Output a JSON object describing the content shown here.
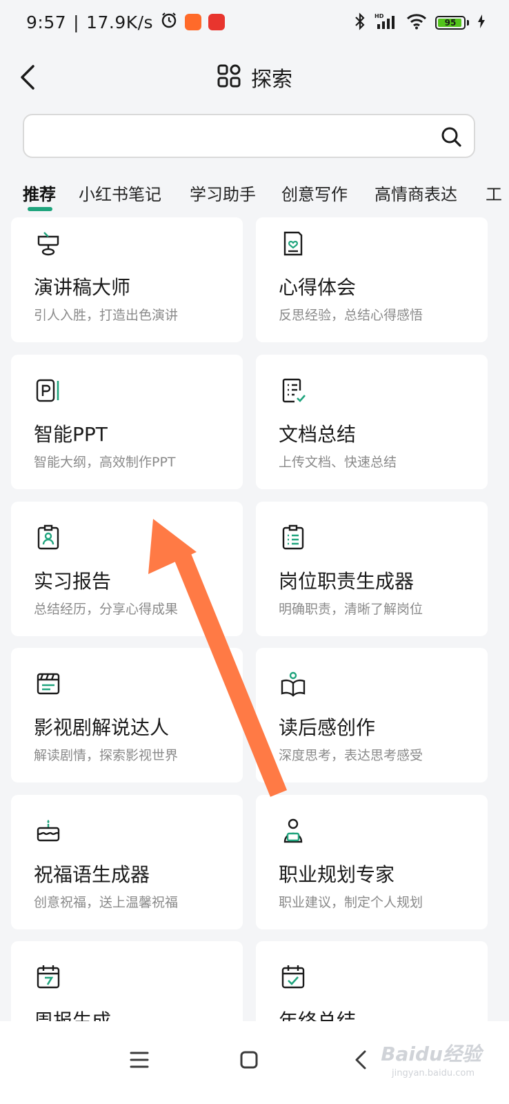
{
  "status_bar": {
    "time": "9:57",
    "speed": "17.9K/s",
    "battery_level": 95,
    "battery_label": "95",
    "network": "HD"
  },
  "header": {
    "title": "探索",
    "back_icon": "chevron-left-icon",
    "title_icon": "grid-apps-icon"
  },
  "search": {
    "placeholder": "",
    "value": ""
  },
  "tabs": [
    {
      "label": "推荐",
      "active": true
    },
    {
      "label": "小红书笔记"
    },
    {
      "label": "学习助手"
    },
    {
      "label": "创意写作"
    },
    {
      "label": "高情商表达"
    },
    {
      "label": "工"
    }
  ],
  "cards": [
    {
      "title": "演讲稿大师",
      "desc": "引人入胜，打造出色演讲",
      "icon": "podium-icon"
    },
    {
      "title": "心得体会",
      "desc": "反思经验，总结心得感悟",
      "icon": "heart-document-icon"
    },
    {
      "title": "智能PPT",
      "desc": "智能大纲，高效制作PPT",
      "icon": "ppt-icon"
    },
    {
      "title": "文档总结",
      "desc": "上传文档、快速总结",
      "icon": "document-check-icon"
    },
    {
      "title": "实习报告",
      "desc": "总结经历，分享心得成果",
      "icon": "badge-person-icon"
    },
    {
      "title": "岗位职责生成器",
      "desc": "明确职责，清晰了解岗位",
      "icon": "clipboard-list-icon"
    },
    {
      "title": "影视剧解说达人",
      "desc": "解读剧情，探索影视世界",
      "icon": "clapperboard-icon"
    },
    {
      "title": "读后感创作",
      "desc": "深度思考，表达思考感受",
      "icon": "reading-book-icon"
    },
    {
      "title": "祝福语生成器",
      "desc": "创意祝福，送上温馨祝福",
      "icon": "cake-icon"
    },
    {
      "title": "职业规划专家",
      "desc": "职业建议，制定个人规划",
      "icon": "person-laptop-icon"
    },
    {
      "title": "周报生成",
      "desc": "",
      "icon": "calendar-7-icon"
    },
    {
      "title": "年终总结",
      "desc": "",
      "icon": "calendar-check-icon"
    }
  ],
  "navbar": {
    "menu_icon": "menu-icon",
    "home_icon": "home-square-icon",
    "back_icon": "back-triangle-icon",
    "watermark": "Baidu经验",
    "watermark_sub": "jingyan.baidu.com"
  },
  "colors": {
    "accent": "#1fa47d",
    "arrow": "#ff7a45",
    "background": "#f4f5f7"
  }
}
